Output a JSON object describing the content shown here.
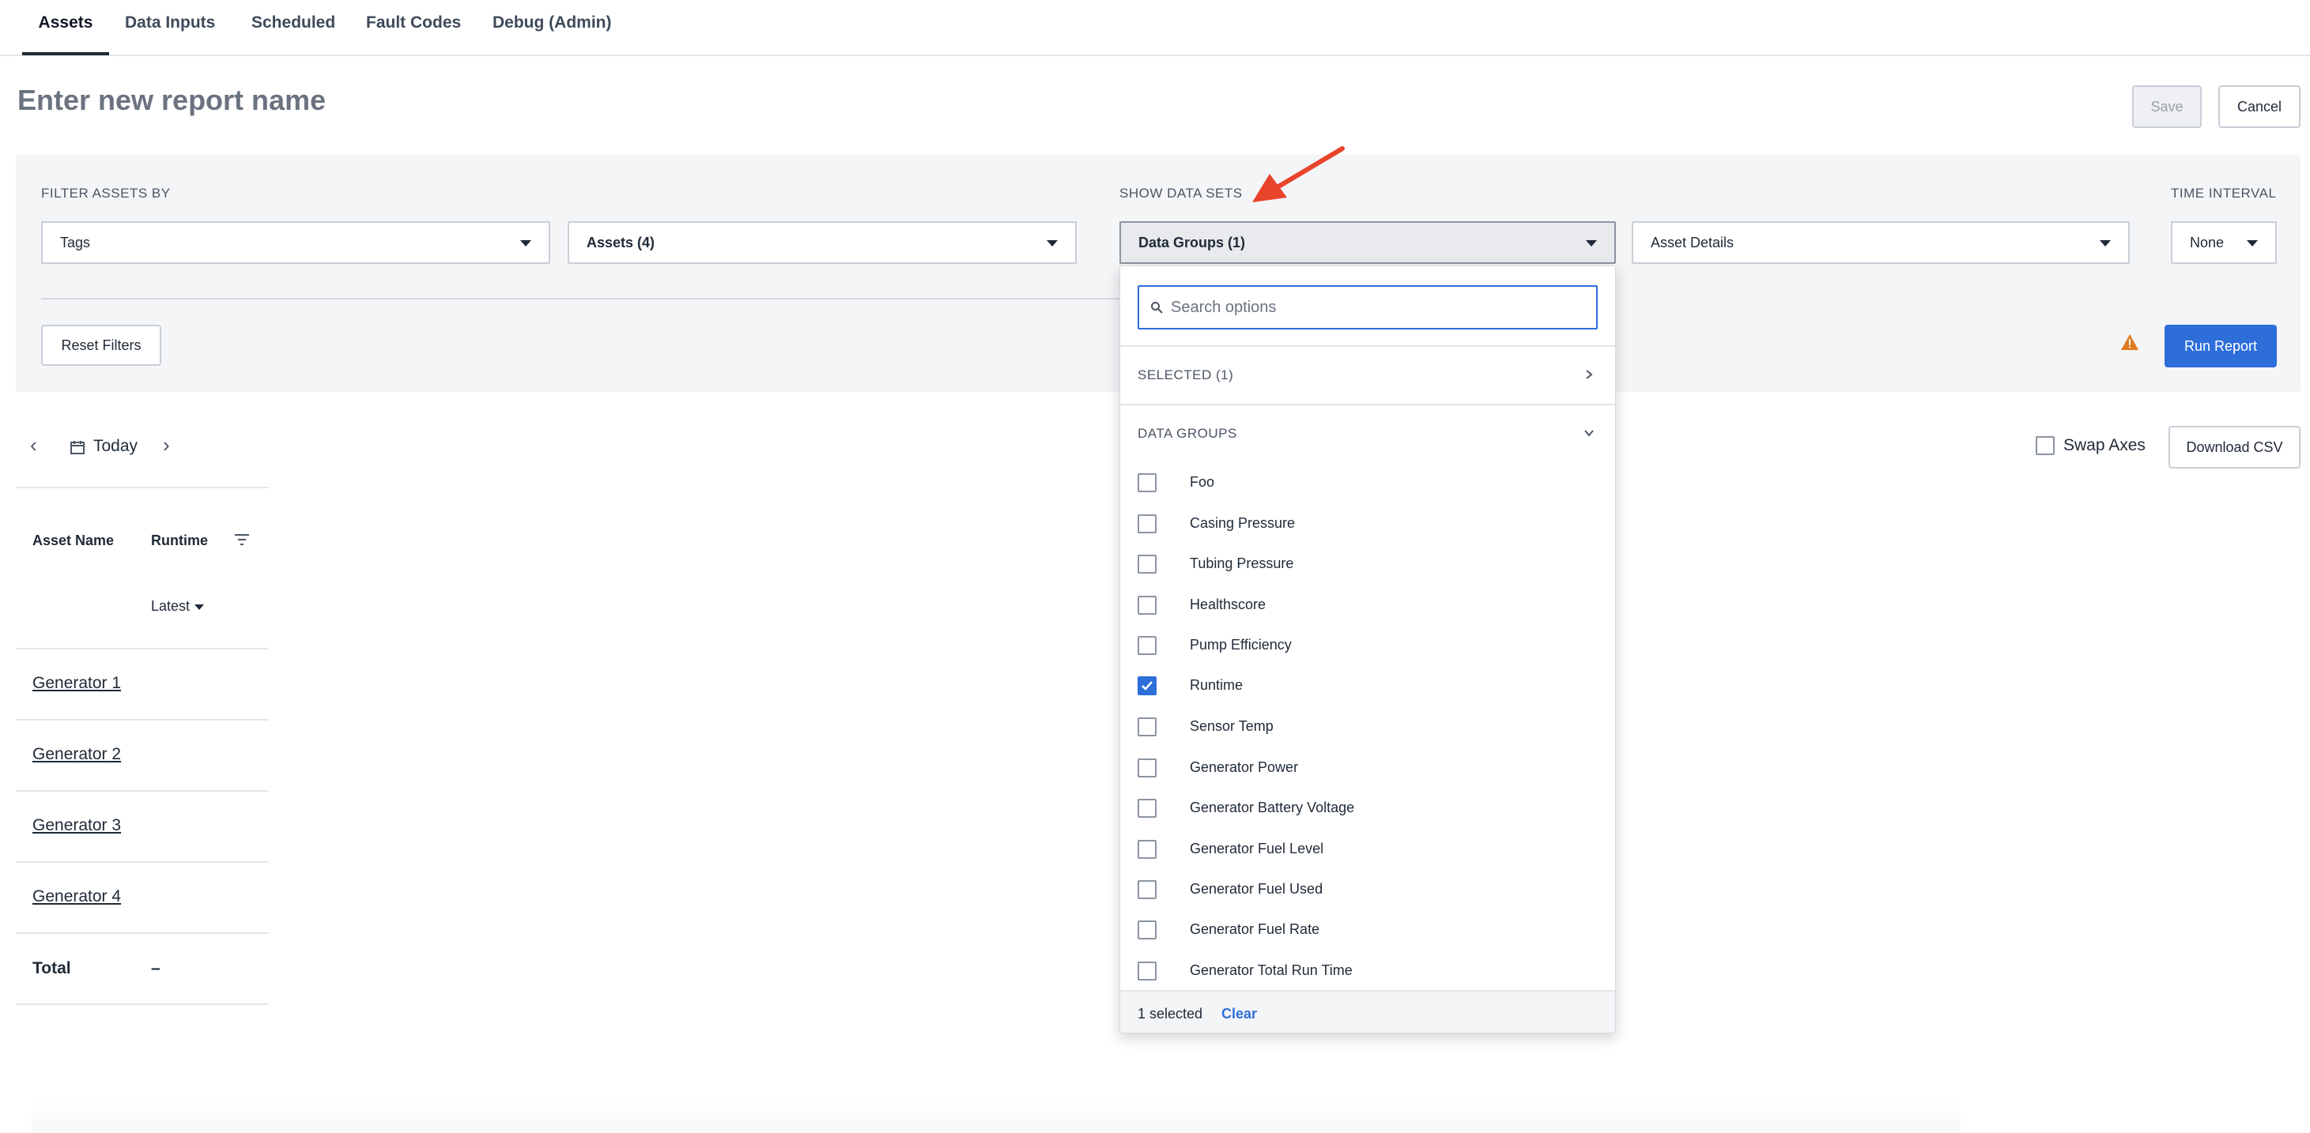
{
  "nav": {
    "tabs": [
      {
        "label": "Assets",
        "active": true
      },
      {
        "label": "Data Inputs"
      },
      {
        "label": "Scheduled"
      },
      {
        "label": "Fault Codes"
      },
      {
        "label": "Debug (Admin)"
      }
    ]
  },
  "header": {
    "title": "Enter new report name",
    "save_label": "Save",
    "cancel_label": "Cancel"
  },
  "filters": {
    "filter_assets_label": "FILTER ASSETS BY",
    "tags_select": "Tags",
    "assets_select": "Assets (4)",
    "show_data_sets_label": "SHOW DATA SETS",
    "data_groups_select": "Data Groups (1)",
    "asset_details_select": "Asset Details",
    "time_interval_label": "TIME INTERVAL",
    "time_interval_select": "None",
    "reset_label": "Reset Filters",
    "run_label": "Run Report"
  },
  "date_nav": {
    "today_label": "Today"
  },
  "swap_axes_label": "Swap Axes",
  "download_label": "Download CSV",
  "table": {
    "headers": [
      "Asset Name",
      "Runtime"
    ],
    "latest_label": "Latest",
    "rows": [
      "Generator 1",
      "Generator 2",
      "Generator 3",
      "Generator 4"
    ],
    "total_label": "Total",
    "total_value": "–"
  },
  "dropdown": {
    "search_placeholder": "Search options",
    "selected_section": "SELECTED (1)",
    "data_groups_section": "DATA GROUPS",
    "options": [
      {
        "label": "Foo",
        "checked": false
      },
      {
        "label": "Casing Pressure",
        "checked": false
      },
      {
        "label": "Tubing Pressure",
        "checked": false
      },
      {
        "label": "Healthscore",
        "checked": false
      },
      {
        "label": "Pump Efficiency",
        "checked": false
      },
      {
        "label": "Runtime",
        "checked": true
      },
      {
        "label": "Sensor Temp",
        "checked": false
      },
      {
        "label": "Generator Power",
        "checked": false
      },
      {
        "label": "Generator Battery Voltage",
        "checked": false
      },
      {
        "label": "Generator Fuel Level",
        "checked": false
      },
      {
        "label": "Generator Fuel Used",
        "checked": false
      },
      {
        "label": "Generator Fuel Rate",
        "checked": false
      },
      {
        "label": "Generator Total Run Time",
        "checked": false
      }
    ],
    "footer_count": "1 selected",
    "footer_clear": "Clear"
  },
  "colors": {
    "accent": "#2d6ed9",
    "annotation_arrow": "#e8432b",
    "warning": "#e07a1f"
  }
}
